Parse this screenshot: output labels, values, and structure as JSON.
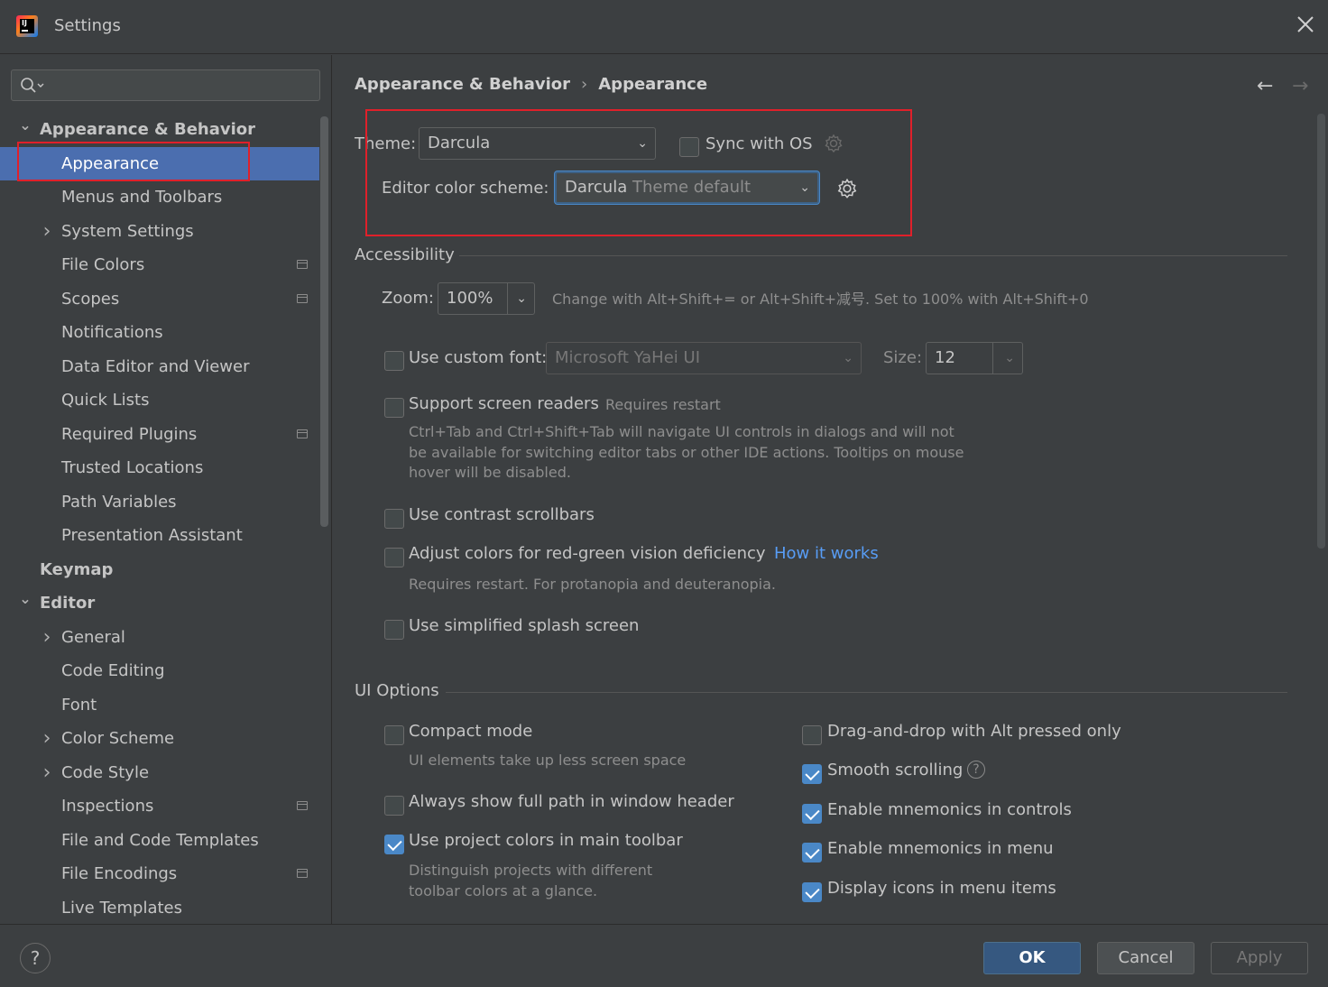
{
  "window": {
    "title": "Settings"
  },
  "sidebar": {
    "search_placeholder": "",
    "items": [
      {
        "label": "Appearance & Behavior",
        "level": 0,
        "expander": "expanded",
        "bold": true
      },
      {
        "label": "Appearance",
        "level": 1,
        "selected": true
      },
      {
        "label": "Menus and Toolbars",
        "level": 1
      },
      {
        "label": "System Settings",
        "level": 1,
        "expander": "collapsed"
      },
      {
        "label": "File Colors",
        "level": 1,
        "project_icon": true
      },
      {
        "label": "Scopes",
        "level": 1,
        "project_icon": true
      },
      {
        "label": "Notifications",
        "level": 1
      },
      {
        "label": "Data Editor and Viewer",
        "level": 1
      },
      {
        "label": "Quick Lists",
        "level": 1
      },
      {
        "label": "Required Plugins",
        "level": 1,
        "project_icon": true
      },
      {
        "label": "Trusted Locations",
        "level": 1
      },
      {
        "label": "Path Variables",
        "level": 1
      },
      {
        "label": "Presentation Assistant",
        "level": 1
      },
      {
        "label": "Keymap",
        "level": 0,
        "bold": true
      },
      {
        "label": "Editor",
        "level": 0,
        "expander": "expanded",
        "bold": true
      },
      {
        "label": "General",
        "level": 1,
        "expander": "collapsed"
      },
      {
        "label": "Code Editing",
        "level": 1
      },
      {
        "label": "Font",
        "level": 1
      },
      {
        "label": "Color Scheme",
        "level": 1,
        "expander": "collapsed"
      },
      {
        "label": "Code Style",
        "level": 1,
        "expander": "collapsed"
      },
      {
        "label": "Inspections",
        "level": 1,
        "project_icon": true
      },
      {
        "label": "File and Code Templates",
        "level": 1
      },
      {
        "label": "File Encodings",
        "level": 1,
        "project_icon": true
      },
      {
        "label": "Live Templates",
        "level": 1
      }
    ]
  },
  "breadcrumb": {
    "parent": "Appearance & Behavior",
    "separator": "›",
    "current": "Appearance"
  },
  "nav": {
    "back": "←",
    "forward": "→"
  },
  "theme": {
    "label": "Theme:",
    "value": "Darcula",
    "sync_label": "Sync with OS",
    "sync_checked": false
  },
  "editor_scheme": {
    "label": "Editor color scheme:",
    "value": "Darcula",
    "value_hint": "Theme default"
  },
  "accessibility": {
    "title": "Accessibility",
    "zoom_label": "Zoom:",
    "zoom_value": "100%",
    "zoom_hint": "Change with Alt+Shift+= or Alt+Shift+减号. Set to 100% with Alt+Shift+0",
    "custom_font_label": "Use custom font:",
    "custom_font_checked": false,
    "custom_font_value": "Microsoft YaHei UI",
    "size_label": "Size:",
    "size_value": "12",
    "screen_readers_label": "Support screen readers",
    "screen_readers_checked": false,
    "screen_readers_tag": "Requires restart",
    "screen_readers_desc": "Ctrl+Tab and Ctrl+Shift+Tab will navigate UI controls in dialogs and will not be available for switching editor tabs or other IDE actions. Tooltips on mouse hover will be disabled.",
    "contrast_scrollbars_label": "Use contrast scrollbars",
    "contrast_scrollbars_checked": false,
    "red_green_label": "Adjust colors for red-green vision deficiency",
    "red_green_checked": false,
    "red_green_link": "How it works",
    "red_green_desc": "Requires restart. For protanopia and deuteranopia.",
    "simplified_splash_label": "Use simplified splash screen",
    "simplified_splash_checked": false
  },
  "ui_options": {
    "title": "UI Options",
    "compact_mode_label": "Compact mode",
    "compact_mode_checked": false,
    "compact_mode_desc": "UI elements take up less screen space",
    "full_path_label": "Always show full path in window header",
    "full_path_checked": false,
    "project_colors_label": "Use project colors in main toolbar",
    "project_colors_checked": true,
    "project_colors_desc": "Distinguish projects with different toolbar colors at a glance.",
    "drag_drop_label": "Drag-and-drop with Alt pressed only",
    "drag_drop_checked": false,
    "smooth_scrolling_label": "Smooth scrolling",
    "smooth_scrolling_checked": true,
    "mnemonics_controls_label": "Enable mnemonics in controls",
    "mnemonics_controls_checked": true,
    "mnemonics_menu_label": "Enable mnemonics in menu",
    "mnemonics_menu_checked": true,
    "menu_icons_label": "Display icons in menu items",
    "menu_icons_checked": true
  },
  "footer": {
    "help": "?",
    "ok": "OK",
    "cancel": "Cancel",
    "apply": "Apply"
  },
  "colors": {
    "background": "#3c3f41",
    "selection": "#4b6eaf",
    "accent": "#4a88c7",
    "link": "#589df6",
    "annotation_box": "#e0202a"
  }
}
